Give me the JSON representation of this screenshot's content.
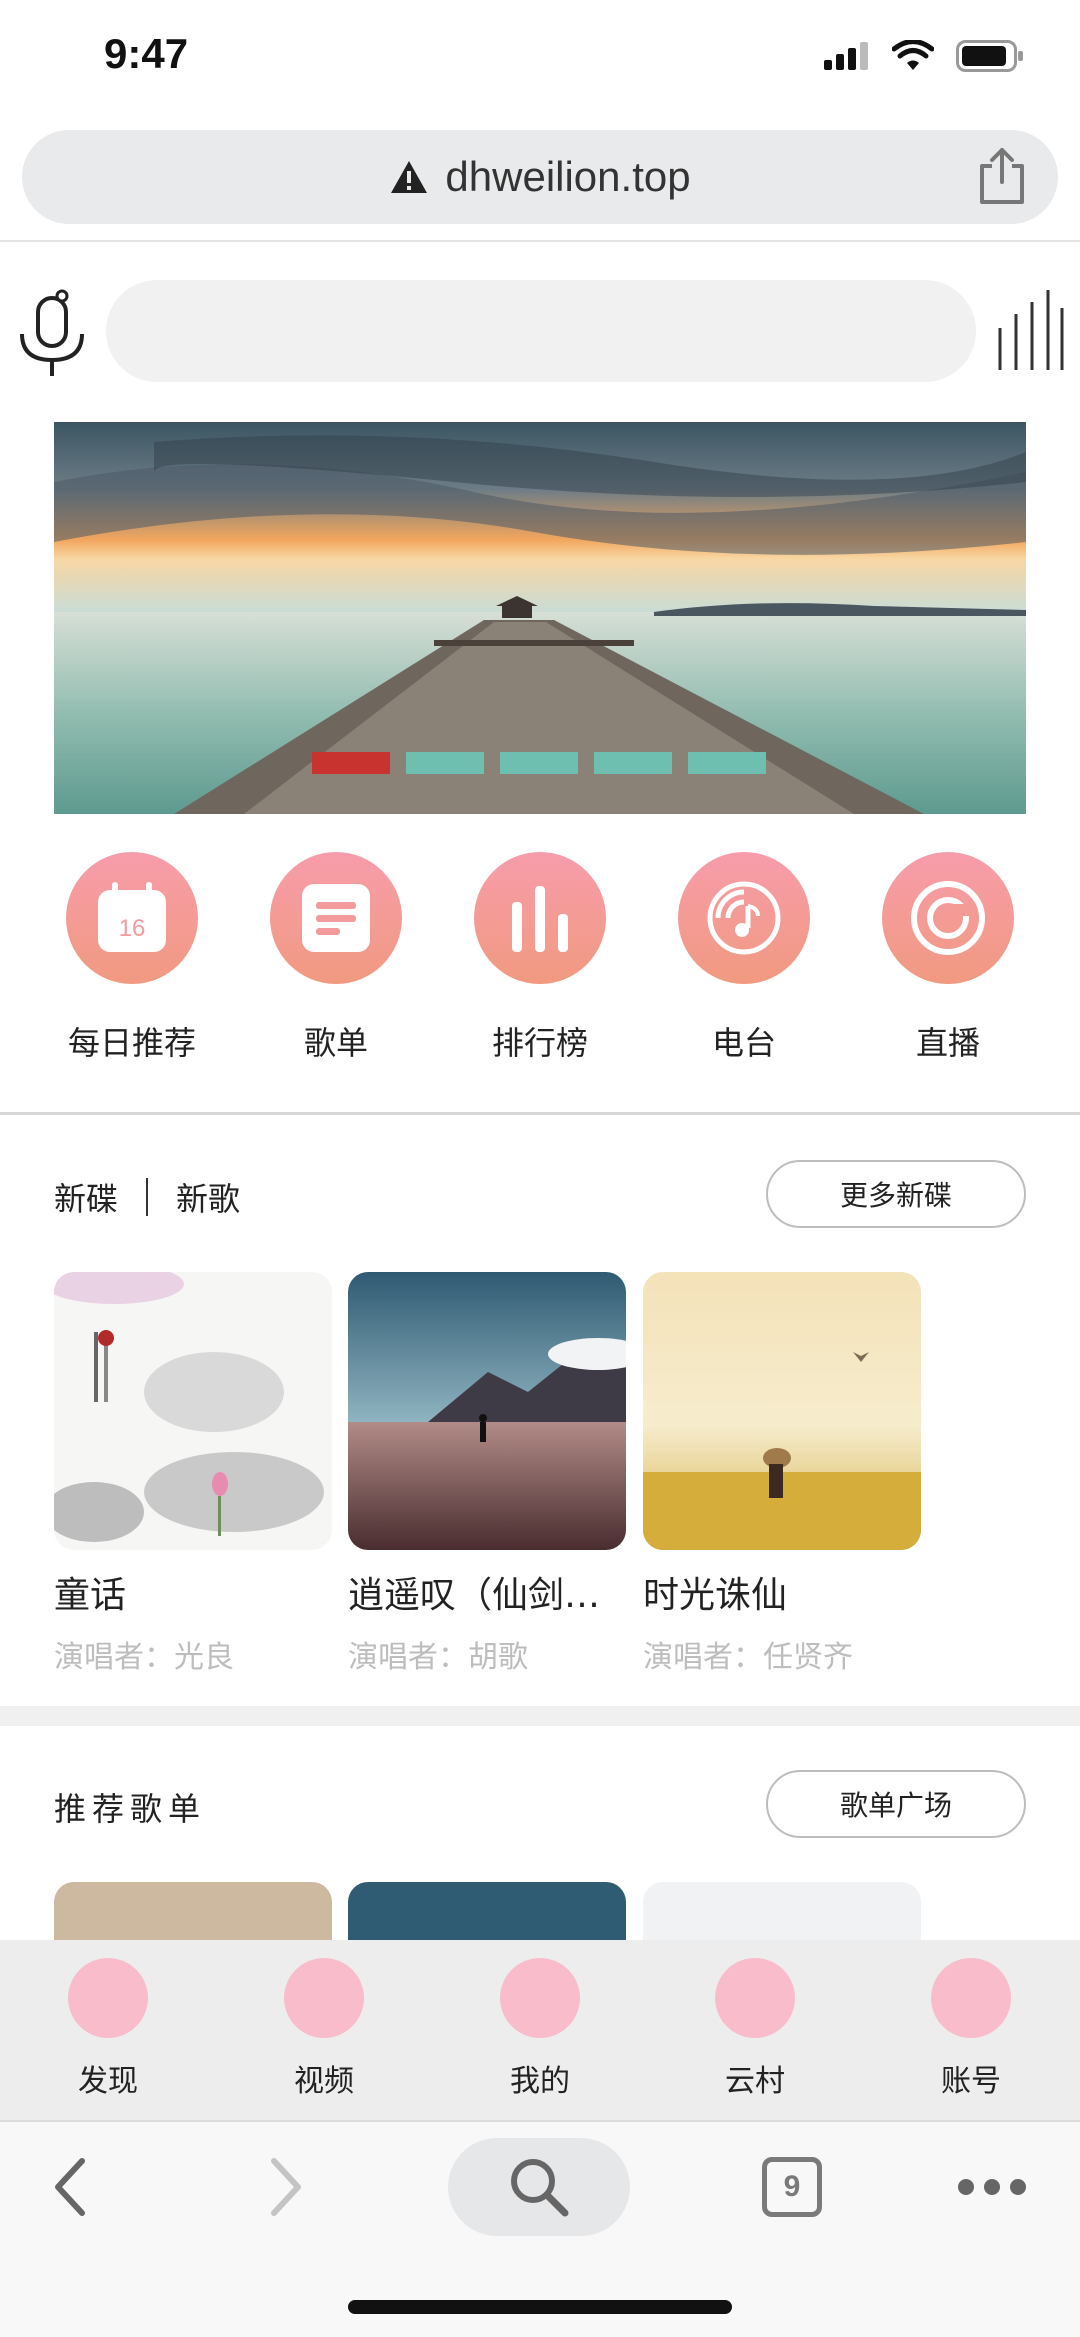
{
  "status": {
    "time": "9:47"
  },
  "browser": {
    "url": "dhweilion.top",
    "tabs_count": "9"
  },
  "search": {
    "placeholder": ""
  },
  "banner": {
    "slides": 5,
    "active_index": 0
  },
  "quick_nav": [
    {
      "label": "每日推荐",
      "icon": "calendar-icon",
      "badge": "16"
    },
    {
      "label": "歌单",
      "icon": "playlist-icon"
    },
    {
      "label": "排行榜",
      "icon": "chart-bars-icon"
    },
    {
      "label": "电台",
      "icon": "radio-icon"
    },
    {
      "label": "直播",
      "icon": "live-icon"
    }
  ],
  "new_section": {
    "tab_album": "新碟",
    "tab_song": "新歌",
    "more_label": "更多新碟",
    "albums": [
      {
        "title": "童话",
        "artist": "演唱者：光良"
      },
      {
        "title": "逍遥叹（仙剑奇侠传）",
        "artist": "演唱者：胡歌"
      },
      {
        "title": "时光诛仙",
        "artist": "演唱者：任贤齐"
      }
    ]
  },
  "playlist_section": {
    "title": "推荐歌单",
    "more_label": "歌单广场"
  },
  "tabbar": [
    {
      "label": "发现"
    },
    {
      "label": "视频"
    },
    {
      "label": "我的"
    },
    {
      "label": "云村"
    },
    {
      "label": "账号"
    }
  ],
  "colors": {
    "accent_gradient_top": "#f79cab",
    "accent_gradient_bottom": "#f19a80",
    "tab_icon": "#f9bccb",
    "dot_active": "#c8322f",
    "dot_inactive": "#6fbfb1"
  }
}
